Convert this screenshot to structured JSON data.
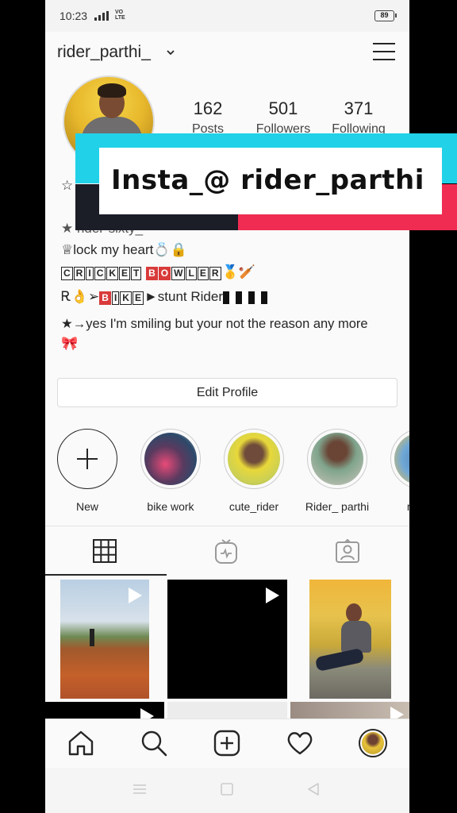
{
  "status_bar": {
    "time": "10:23",
    "volte": "VO LTE",
    "battery": "89"
  },
  "profile": {
    "username": "rider_parthi_",
    "stats": [
      {
        "value": "162",
        "label": "Posts"
      },
      {
        "value": "501",
        "label": "Followers"
      },
      {
        "value": "371",
        "label": "Following"
      }
    ],
    "bio": {
      "line_star": "☆",
      "line2": "★ rider-sixty_",
      "line3_text": "♕lock my heart",
      "line3_emoji": "💍🔒",
      "cricket_letters": [
        "C",
        "R",
        "I",
        "C",
        "K",
        "E",
        "T"
      ],
      "bowler_letters_red": [
        "B",
        "O"
      ],
      "bowler_letters": [
        "W",
        "L",
        "E",
        "R"
      ],
      "cricket_emoji": "🥇🏏",
      "bike_prefix": "Ꭱ👌➢",
      "bike_letters": [
        "B",
        "I",
        "K",
        "E"
      ],
      "bike_text": "►stunt Rider",
      "line6": "★→yes I'm smiling but your not the reason any more",
      "line7_emoji": "🎀"
    },
    "edit_button": "Edit Profile"
  },
  "highlights": [
    {
      "label": "New"
    },
    {
      "label": "bike work"
    },
    {
      "label": "cute_rider"
    },
    {
      "label": "Rider_ parthi"
    },
    {
      "label": "my fa"
    }
  ],
  "overlay": {
    "text": "Insta_@ rider_parthi"
  },
  "colors": {
    "overlay_cyan": "#21d1e8",
    "overlay_red": "#f02c52",
    "overlay_dark": "#1b1d27"
  },
  "icons": {
    "tabs": [
      "grid-icon",
      "igtv-icon",
      "tagged-icon"
    ],
    "nav": [
      "home-icon",
      "search-icon",
      "add-post-icon",
      "heart-icon",
      "profile-avatar"
    ],
    "system": [
      "recents-icon",
      "home-square-icon",
      "back-triangle-icon"
    ]
  }
}
